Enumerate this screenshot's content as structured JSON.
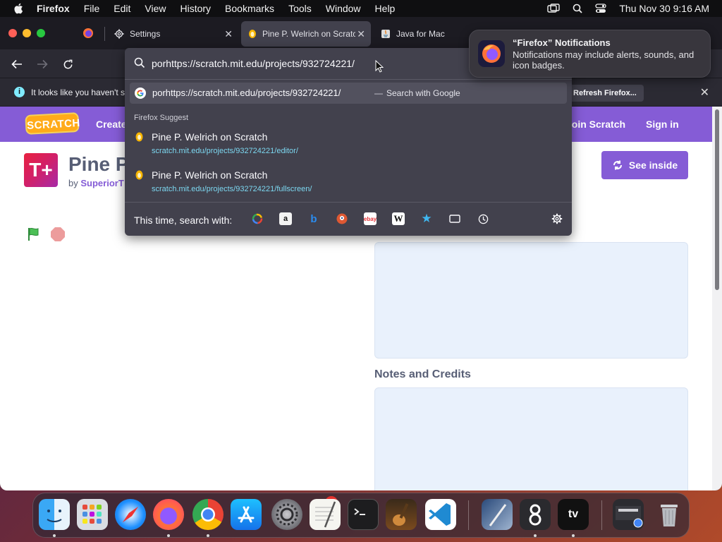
{
  "menubar": {
    "app_name": "Firefox",
    "items": [
      "File",
      "Edit",
      "View",
      "History",
      "Bookmarks",
      "Tools",
      "Window",
      "Help"
    ],
    "datetime": "Thu Nov 30  9:16 AM"
  },
  "tabs": [
    {
      "label": "Settings",
      "icon": "gear-icon"
    },
    {
      "label": "Pine P. Welrich on Scratch",
      "icon": "scratch-cat-icon"
    },
    {
      "label": "Java for Mac",
      "icon": "java-icon"
    }
  ],
  "infobar": {
    "message": "It looks like you haven't st",
    "button": "Refresh Firefox..."
  },
  "urlbar": {
    "value": "porhttps://scratch.mit.edu/projects/932724221/",
    "google_suggestion": "porhttps://scratch.mit.edu/projects/932724221/",
    "google_dash": "—",
    "google_action": "Search with Google",
    "suggest_header": "Firefox Suggest",
    "suggestions": [
      {
        "title": "Pine P. Welrich on Scratch",
        "url": "scratch.mit.edu/projects/932724221/editor/"
      },
      {
        "title": "Pine P. Welrich on Scratch",
        "url": "scratch.mit.edu/projects/932724221/fullscreen/"
      }
    ],
    "engines_label": "This time, search with:",
    "engines": [
      "Google",
      "Amazon",
      "Bing",
      "DuckDuckGo",
      "eBay",
      "Wikipedia",
      "Bookmarks",
      "Tabs",
      "History"
    ]
  },
  "notification": {
    "title": "“Firefox” Notifications",
    "body": "Notifications may include alerts, sounds, and icon badges."
  },
  "scratch": {
    "logo": "SCRATCH",
    "nav_create": "Create",
    "nav_join": "Join Scratch",
    "nav_signin": "Sign in",
    "project_thumb_text": "T+",
    "project_title": "Pine P",
    "by_label": "by",
    "author": "SuperiorT",
    "see_inside": "See inside",
    "notes_title": "Notes and Credits"
  },
  "dock": {
    "apps": [
      "Finder",
      "Launchpad",
      "Safari",
      "Firefox",
      "Chrome",
      "App Store",
      "System Settings",
      "TextEdit",
      "Terminal",
      "GarageBand",
      "Visual Studio Code",
      "Xcode Instruments",
      "Screen Sharing",
      "Apple TV",
      "Downloads",
      "Trash"
    ],
    "settings_badge": "1",
    "appletv_label": "tv"
  },
  "colors": {
    "scratch_purple": "#855cd6",
    "firefox_dark": "#1c1b22",
    "url_panel": "#42414d",
    "link_cyan": "#7cd7f0"
  }
}
